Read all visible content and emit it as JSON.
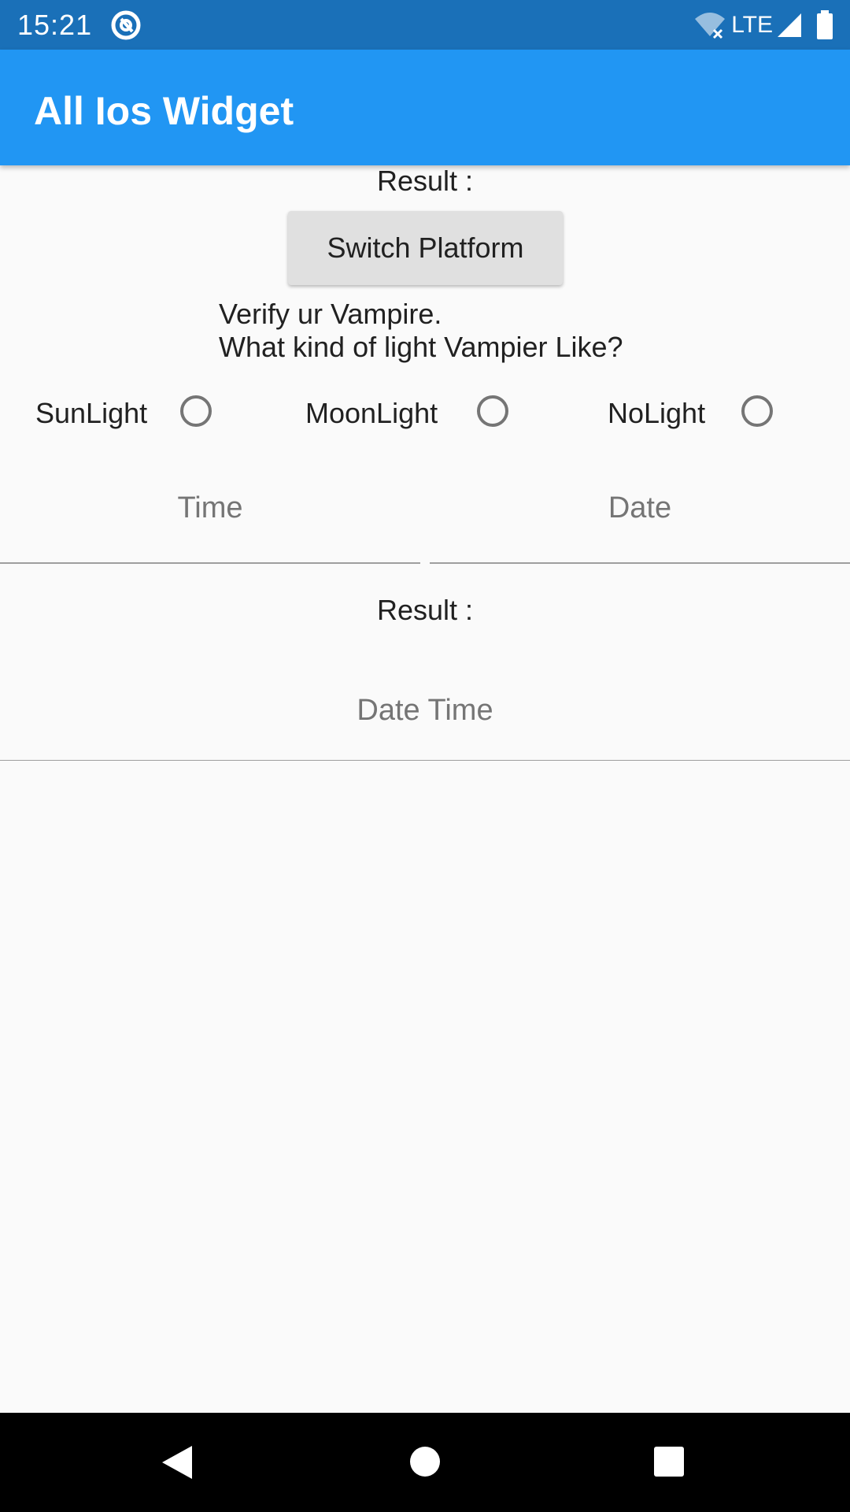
{
  "status_bar": {
    "time": "15:21",
    "network": "LTE",
    "icons": [
      "app-notification-icon",
      "wifi-off-icon",
      "signal-icon",
      "battery-icon"
    ]
  },
  "app_bar": {
    "title": "All Ios Widget"
  },
  "result_top": "Result :",
  "switch_button": "Switch Platform",
  "question": {
    "line1": "Verify ur Vampire.",
    "line2": "What kind of light Vampier Like?"
  },
  "radios": [
    {
      "label": "SunLight",
      "selected": false
    },
    {
      "label": "MoonLight",
      "selected": false
    },
    {
      "label": "NoLight",
      "selected": false
    }
  ],
  "fields": {
    "time_placeholder": "Time",
    "date_placeholder": "Date",
    "datetime_placeholder": "Date Time"
  },
  "result_mid": "Result :",
  "nav": {
    "icons": [
      "back-icon",
      "home-icon",
      "recents-icon"
    ]
  },
  "colors": {
    "status_bar": "#1a70b8",
    "app_bar": "#2196f3",
    "background": "#fafafa",
    "button": "#e0e0e0",
    "placeholder": "#757575"
  }
}
